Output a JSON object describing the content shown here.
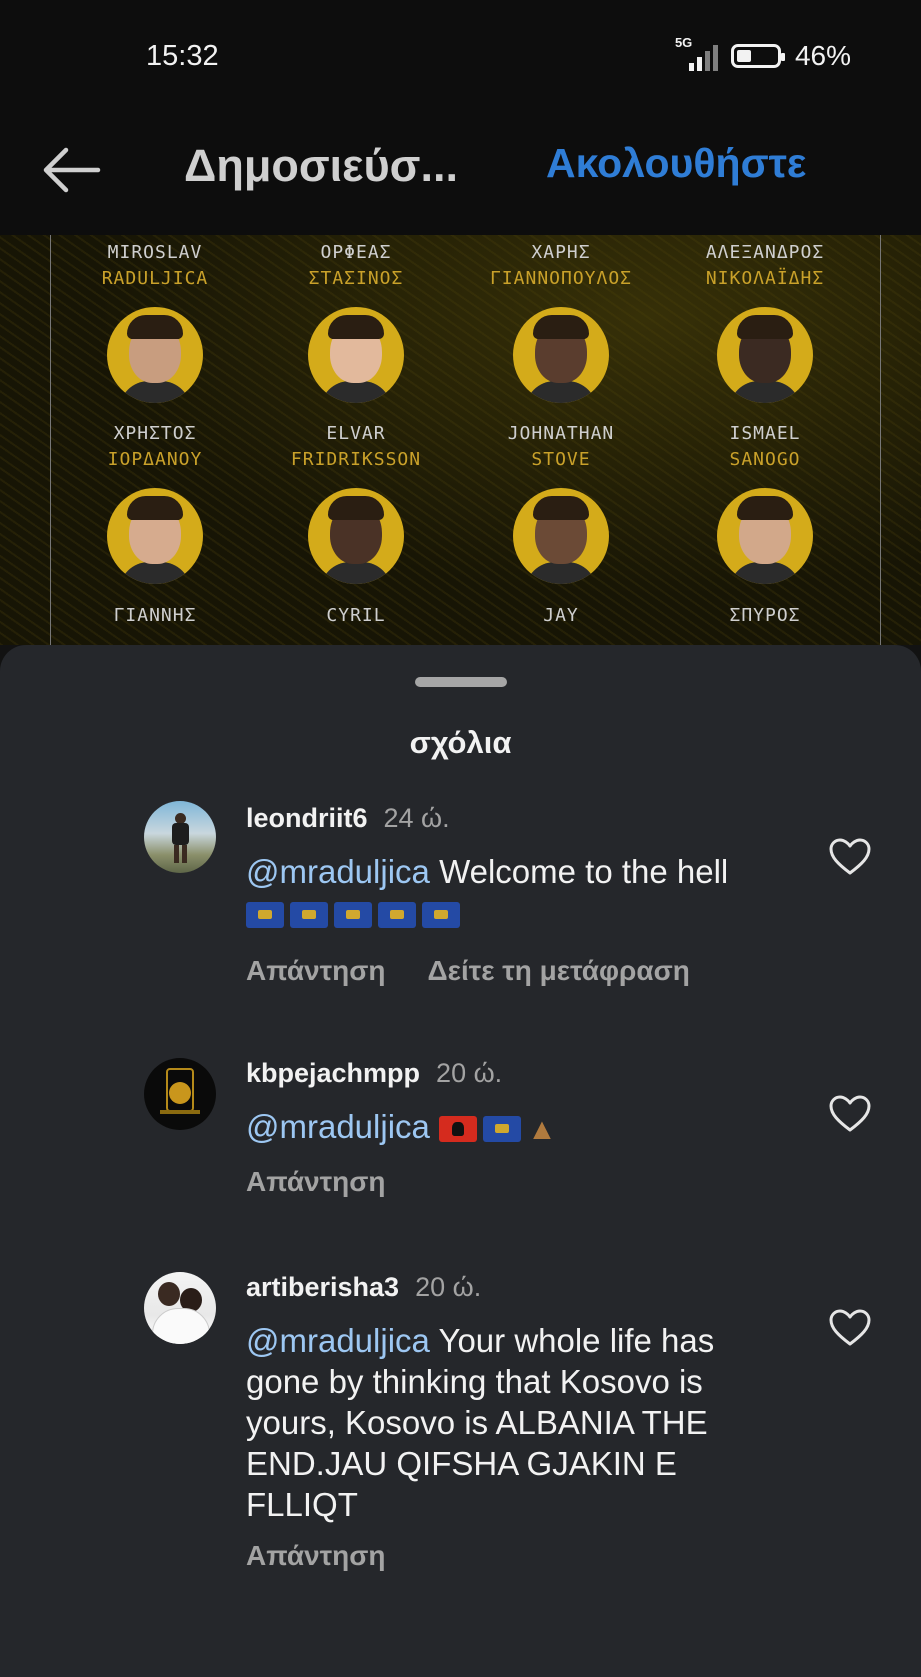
{
  "status_bar": {
    "time": "15:32",
    "network": "5G",
    "battery": "46%",
    "battery_level": 0.46
  },
  "header": {
    "title": "Δημοσιεύσ...",
    "follow_label": "Ακολουθήστε"
  },
  "post": {
    "players": [
      {
        "first": "MIROSLAV",
        "last": "RADULJICA"
      },
      {
        "first": "ΟΡΦΕΑΣ",
        "last": "ΣΤΑΣΙΝΟΣ"
      },
      {
        "first": "ΧΑΡΗΣ",
        "last": "ΓΙΑΝΝΟΠΟΥΛΟΣ"
      },
      {
        "first": "ΑΛΕΞΑΝΔΡΟΣ",
        "last": "ΝΙΚΟΛΑΪΔΗΣ"
      },
      {
        "first": "ΧΡΗΣΤΟΣ",
        "last": "ΙΟΡΔΑΝΟΥ"
      },
      {
        "first": "ELVAR",
        "last": "FRIDRIKSSON"
      },
      {
        "first": "JOHNATHAN",
        "last": "STOVE"
      },
      {
        "first": "ISMAEL",
        "last": "SANOGO"
      },
      {
        "first": "ΓΙΑΝΝΗΣ",
        "last": ""
      },
      {
        "first": "CYRIL",
        "last": ""
      },
      {
        "first": "JAY",
        "last": ""
      },
      {
        "first": "ΣΠΥΡΟΣ",
        "last": ""
      }
    ]
  },
  "comments_sheet": {
    "title": "σχόλια",
    "comments": [
      {
        "username": "leondriit6",
        "time": "24 ώ.",
        "mention": "@mraduljica",
        "text": "Welcome to the hell",
        "reply_label": "Απάντηση",
        "translate_label": "Δείτε τη μετάφραση"
      },
      {
        "username": "kbpejachmpp",
        "time": "20 ώ.",
        "mention": "@mraduljica",
        "text": "",
        "reply_label": "Απάντηση"
      },
      {
        "username": "artiberisha3",
        "time": "20 ώ.",
        "mention": "@mraduljica",
        "text": "Your whole life has gone by thinking that Kosovo is yours, Kosovo is ALBANIA THE END.JAU QIFSHA GJAKIN E FLLIQT",
        "reply_label": "Απάντηση"
      }
    ]
  },
  "icons": [
    "back-arrow-icon",
    "heart-icon",
    "kosovo-flag-emoji",
    "albania-flag-emoji",
    "eagle-emoji"
  ],
  "colors": {
    "accent": "#2f7dd6",
    "mention": "#9dc7f2",
    "sheet_bg": "#25272b",
    "gold": "#d4ab1a"
  }
}
